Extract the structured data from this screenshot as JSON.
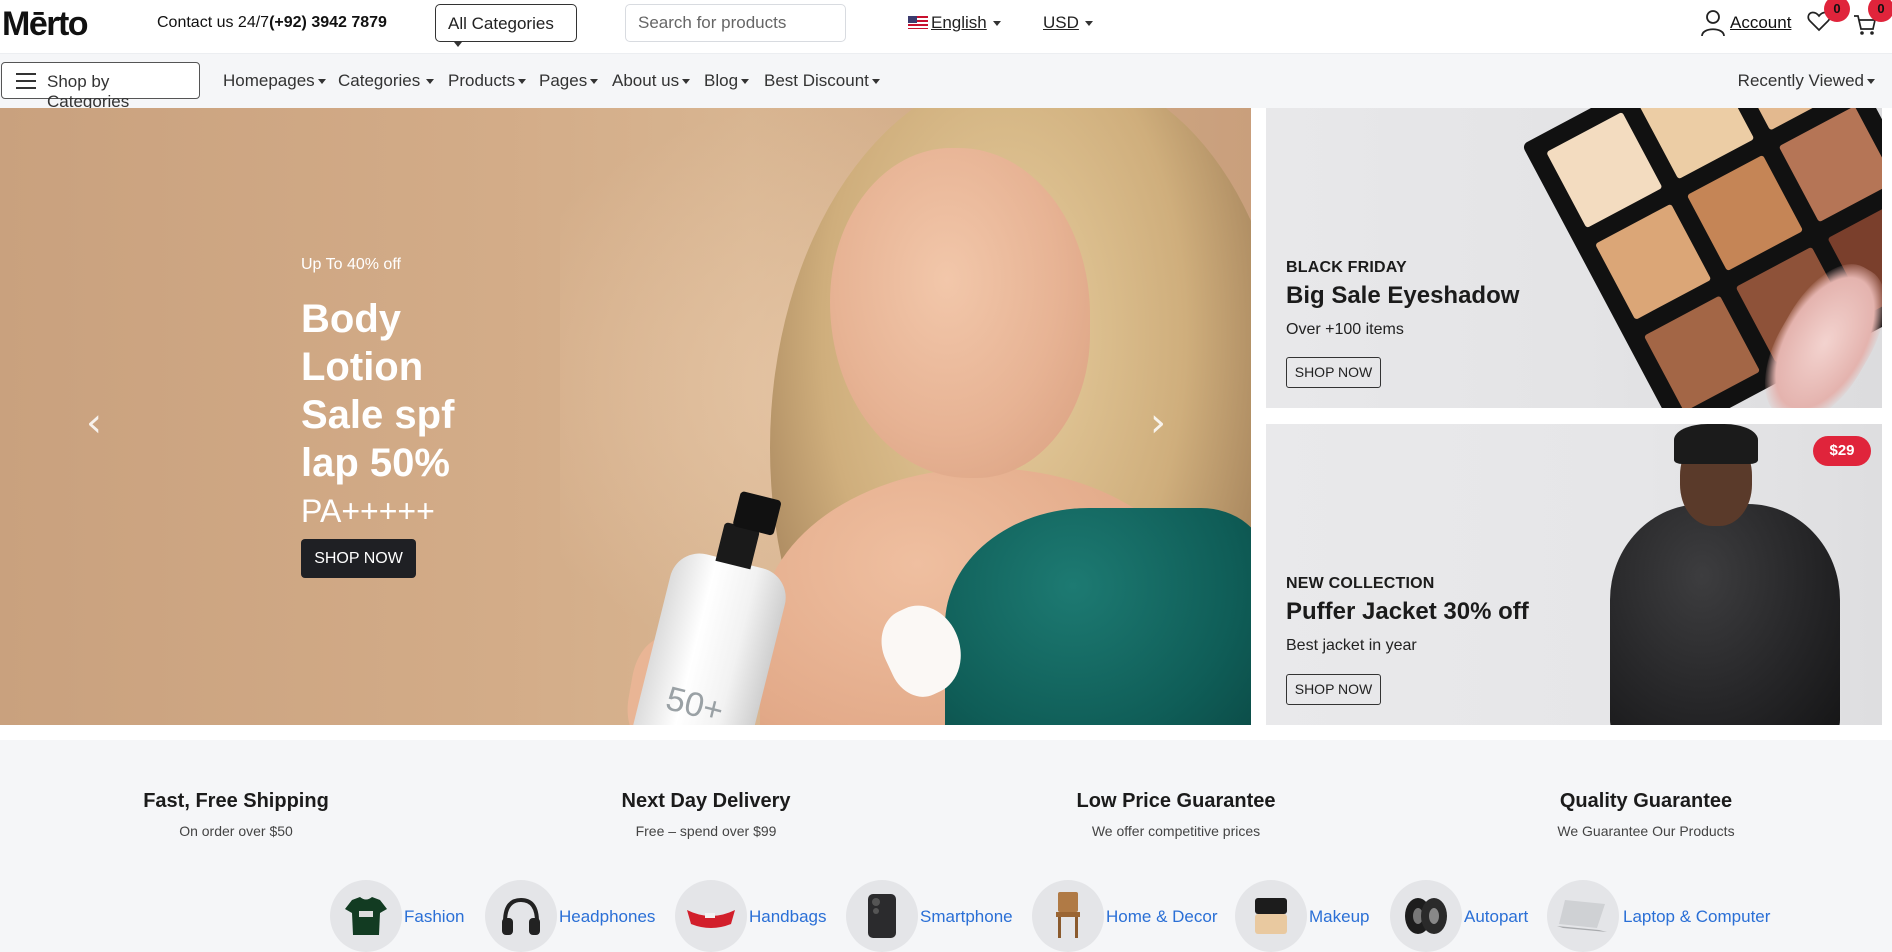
{
  "header": {
    "logo": "Mērto",
    "contact_prefix": "Contact us 24/7",
    "contact_phone": "(+92) 3942 7879",
    "all_categories": "All Categories",
    "search_placeholder": "Search for products",
    "language": "English",
    "currency": "USD",
    "account": "Account",
    "wishlist_count": "0",
    "cart_count": "0"
  },
  "nav": {
    "shop_by": "Shop by Categories",
    "items": [
      "Homepages",
      "Categories",
      "Products",
      "Pages",
      "About us",
      "Blog",
      "Best Discount"
    ],
    "recently_viewed": "Recently Viewed"
  },
  "hero": {
    "subtitle": "Up To 40% off",
    "title": "Body Lotion Sale spf lap 50%",
    "title2": "PA+++++",
    "button": "SHOP NOW",
    "bottle_text": "50+",
    "prev_icon": "‹",
    "next_icon": "›"
  },
  "banners": [
    {
      "label": "BLACK FRIDAY",
      "title": "Big Sale Eyeshadow",
      "desc": "Over +100 items",
      "button": "SHOP NOW"
    },
    {
      "label": "NEW COLLECTION",
      "title": "Puffer Jacket 30% off",
      "desc": "Best jacket in year",
      "button": "SHOP NOW",
      "price": "$29"
    }
  ],
  "features": [
    {
      "title": "Fast, Free Shipping",
      "desc": "On order over $50"
    },
    {
      "title": "Next Day Delivery",
      "desc": "Free – spend over $99"
    },
    {
      "title": "Low Price Guarantee",
      "desc": "We offer competitive prices"
    },
    {
      "title": "Quality Guarantee",
      "desc": "We Guarantee Our Products"
    }
  ],
  "categories": [
    {
      "label": "Fashion",
      "icon": "tshirt-icon"
    },
    {
      "label": "Headphones",
      "icon": "headphones-icon"
    },
    {
      "label": "Handbags",
      "icon": "handbag-icon"
    },
    {
      "label": "Smartphone",
      "icon": "smartphone-icon"
    },
    {
      "label": "Home & Decor",
      "icon": "chair-icon"
    },
    {
      "label": "Makeup",
      "icon": "makeup-icon"
    },
    {
      "label": "Autopart",
      "icon": "tire-icon"
    },
    {
      "label": "Laptop & Computer",
      "icon": "laptop-icon"
    }
  ],
  "colors": {
    "accent_badge": "#e0243b",
    "link": "#2a6fd6",
    "dark_button": "#1f2024"
  }
}
